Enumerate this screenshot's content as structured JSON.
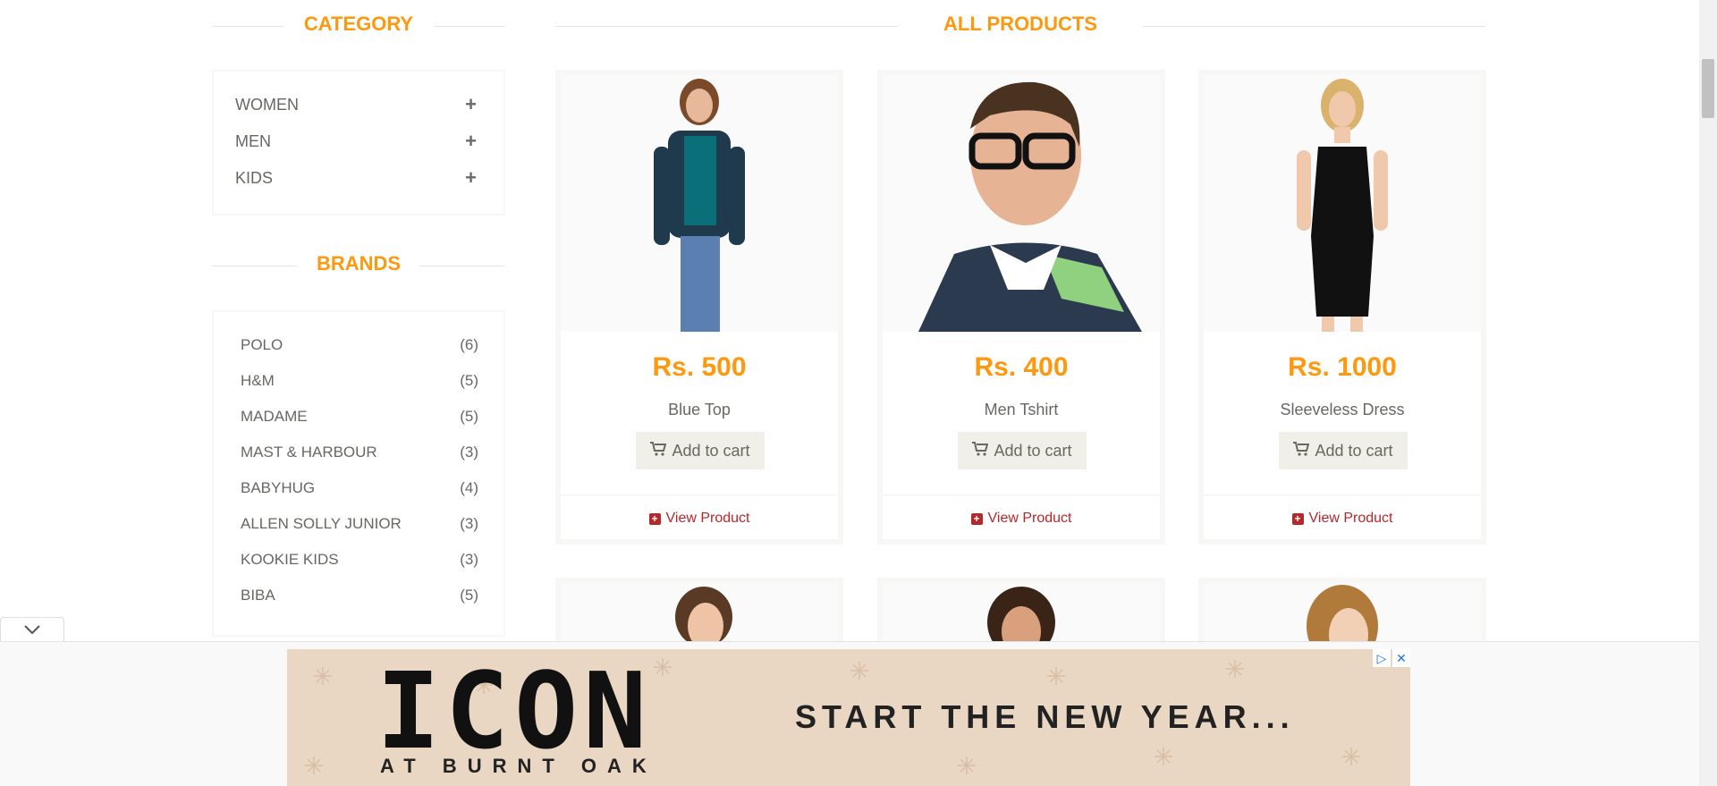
{
  "category": {
    "heading": "CATEGORY",
    "items": [
      {
        "label": "WOMEN"
      },
      {
        "label": "MEN"
      },
      {
        "label": "KIDS"
      }
    ]
  },
  "brands": {
    "heading": "BRANDS",
    "items": [
      {
        "label": "POLO",
        "count": "(6)"
      },
      {
        "label": "H&M",
        "count": "(5)"
      },
      {
        "label": "MADAME",
        "count": "(5)"
      },
      {
        "label": "MAST & HARBOUR",
        "count": "(3)"
      },
      {
        "label": "BABYHUG",
        "count": "(4)"
      },
      {
        "label": "ALLEN SOLLY JUNIOR",
        "count": "(3)"
      },
      {
        "label": "KOOKIE KIDS",
        "count": "(3)"
      },
      {
        "label": "BIBA",
        "count": "(5)"
      }
    ]
  },
  "products": {
    "heading": "ALL PRODUCTS",
    "add_to_cart_label": "Add to cart",
    "view_product_label": "View Product",
    "items": [
      {
        "price": "Rs. 500",
        "name": "Blue Top"
      },
      {
        "price": "Rs. 400",
        "name": "Men Tshirt"
      },
      {
        "price": "Rs. 1000",
        "name": "Sleeveless Dress"
      }
    ]
  },
  "ad": {
    "brand": "ICON",
    "sub": "AT BURNT OAK",
    "tagline": "START THE NEW YEAR...",
    "adchoices_icon": "adchoices-icon",
    "close_icon": "close-icon"
  },
  "colors": {
    "accent": "#fe980f",
    "link": "#b6272a"
  }
}
